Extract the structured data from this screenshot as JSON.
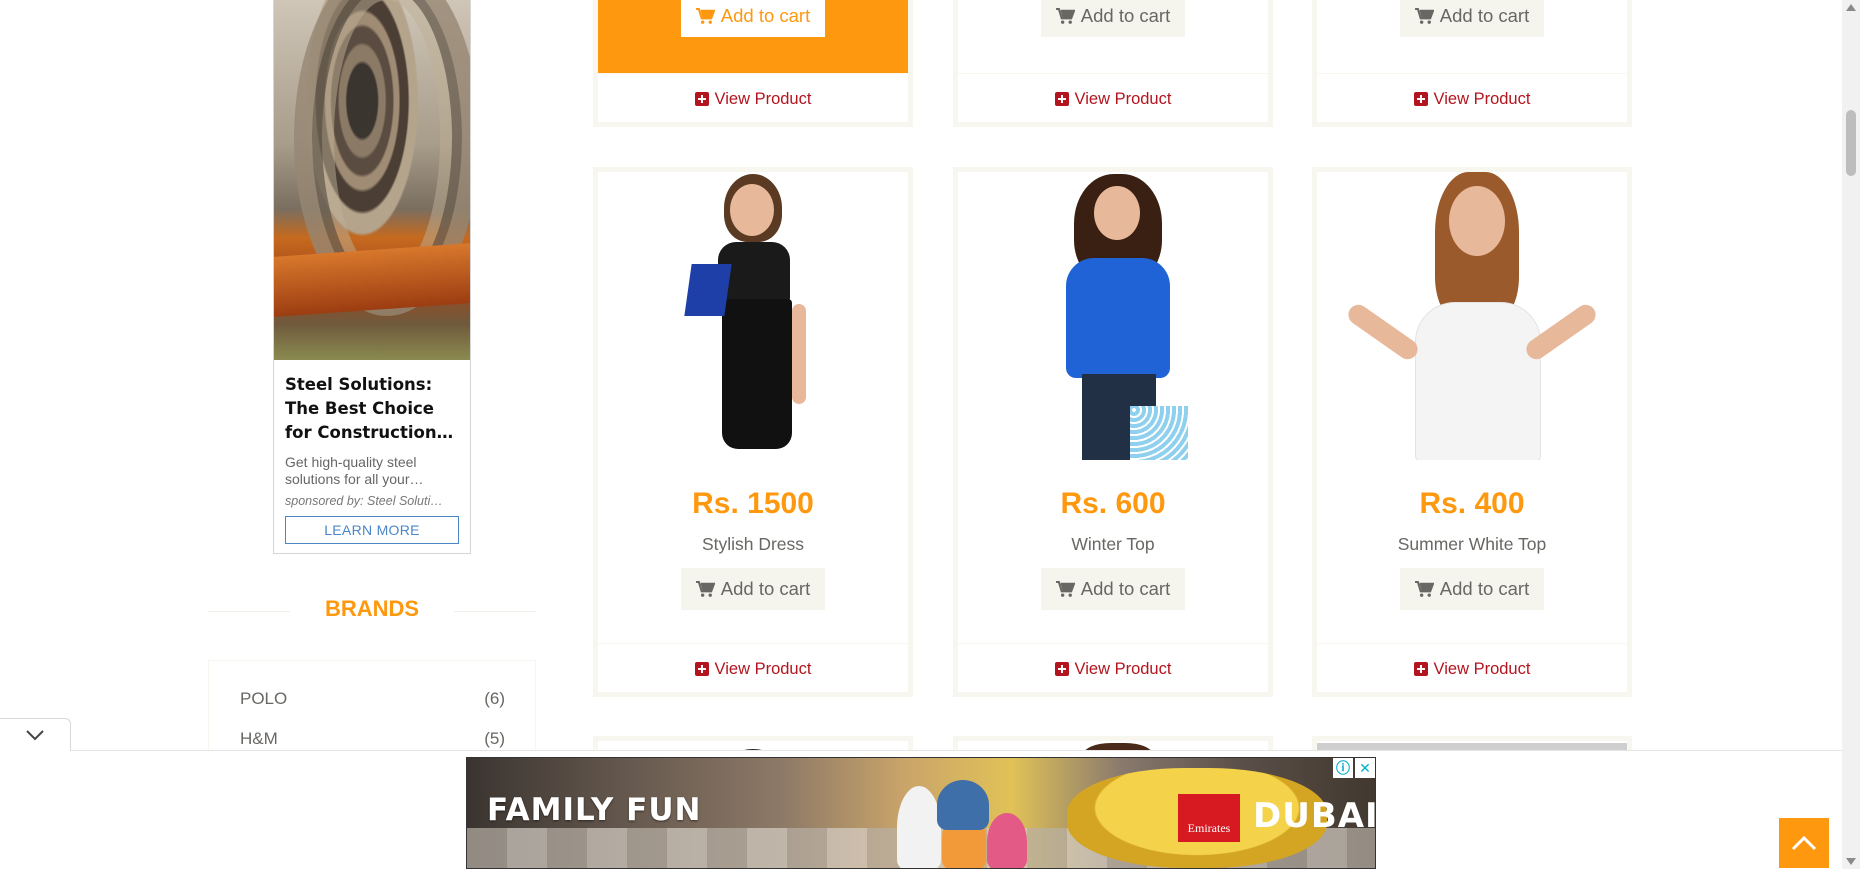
{
  "sidebar_ad": {
    "title": "Steel Solutions: The Best Choice for Construction…",
    "description": "Get high-quality steel solutions for all your…",
    "sponsor": "sponsored by: Steel Soluti…",
    "button_label": "LEARN MORE"
  },
  "brands": {
    "title": "BRANDS",
    "items": [
      {
        "name": "POLO",
        "count": "(6)"
      },
      {
        "name": "H&M",
        "count": "(5)"
      }
    ]
  },
  "top_row": [
    {
      "cart_label": "Add to cart",
      "view_label": "View Product",
      "highlighted": true
    },
    {
      "cart_label": "Add to cart",
      "view_label": "View Product",
      "highlighted": false
    },
    {
      "cart_label": "Add to cart",
      "view_label": "View Product",
      "highlighted": false
    }
  ],
  "products": [
    {
      "price": "Rs. 1500",
      "name": "Stylish Dress",
      "cart_label": "Add to cart",
      "view_label": "View Product"
    },
    {
      "price": "Rs. 600",
      "name": "Winter Top",
      "cart_label": "Add to cart",
      "view_label": "View Product"
    },
    {
      "price": "Rs. 400",
      "name": "Summer White Top",
      "cart_label": "Add to cart",
      "view_label": "View Product"
    }
  ],
  "bottom_ad": {
    "headline": "FAMILY FUN",
    "airline": "Emirates",
    "city": "DUBAI"
  },
  "colors": {
    "accent": "#FE980F",
    "link": "#B4141E",
    "button_bg": "#F5F5ED"
  },
  "icons": [
    "cart-icon",
    "plus-square-icon",
    "chevron-down-icon",
    "chevron-up-icon",
    "ad-info-icon",
    "close-icon"
  ]
}
